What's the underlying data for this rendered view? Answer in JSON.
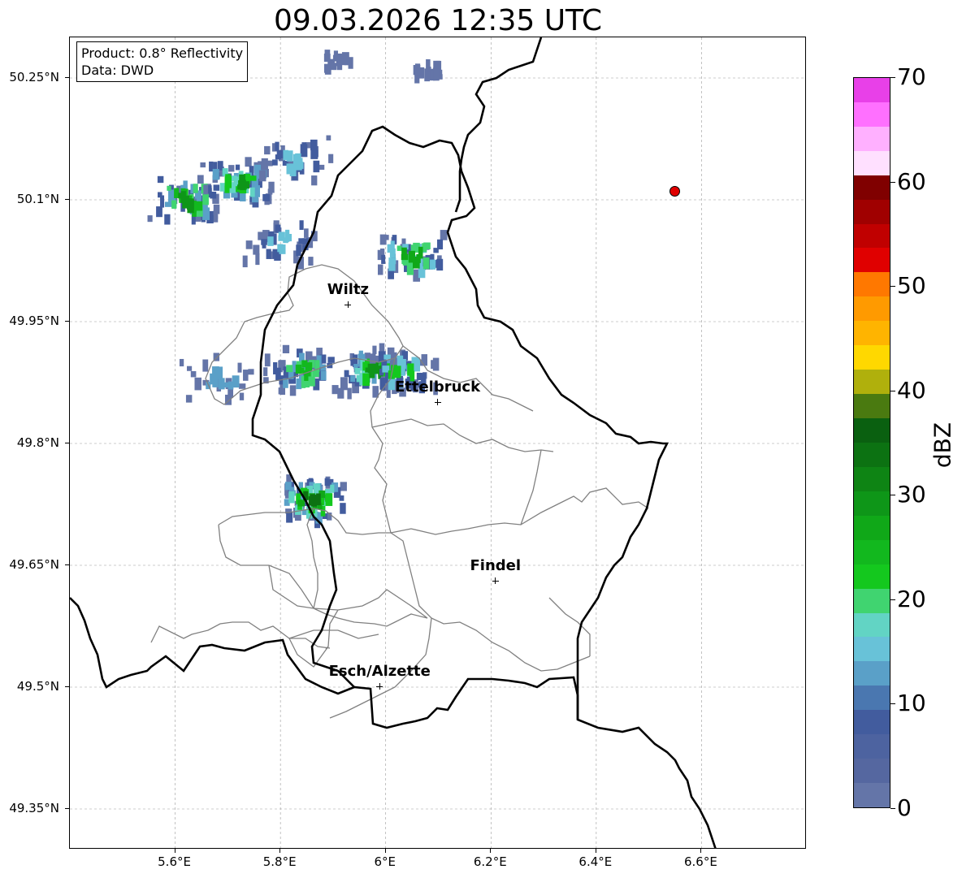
{
  "title": "09.03.2026 12:35 UTC",
  "info_box": {
    "product": "Product: 0.8° Reflectivity",
    "data": "Data: DWD"
  },
  "axes": {
    "lon_ticks": [
      "5.6°E",
      "5.8°E",
      "6°E",
      "6.2°E",
      "6.4°E",
      "6.6°E"
    ],
    "lat_ticks": [
      "50.25°N",
      "50.1°N",
      "49.95°N",
      "49.8°N",
      "49.65°N",
      "49.5°N",
      "49.35°N"
    ],
    "lon_range": [
      5.4,
      6.8
    ],
    "lat_range": [
      49.3,
      50.3
    ],
    "grid": true
  },
  "cities": [
    {
      "name": "Wiltz",
      "lon": 5.93,
      "lat": 49.97
    },
    {
      "name": "Ettelbruck",
      "lon": 6.1,
      "lat": 49.85
    },
    {
      "name": "Findel",
      "lon": 6.21,
      "lat": 49.63
    },
    {
      "name": "Esch/Alzette",
      "lon": 5.99,
      "lat": 49.5
    }
  ],
  "radar_site": {
    "lon": 6.55,
    "lat": 50.11,
    "color": "#e00000"
  },
  "colorbar": {
    "label": "dBZ",
    "ticks": [
      "0",
      "10",
      "20",
      "30",
      "40",
      "50",
      "60",
      "70"
    ],
    "range": [
      0,
      70
    ],
    "colors": [
      "#6475a8",
      "#5567a0",
      "#4d63a0",
      "#425c9e",
      "#4a77b0",
      "#5aa0c8",
      "#68c2d8",
      "#62d4c4",
      "#40d470",
      "#14c81e",
      "#12b81e",
      "#10a818",
      "#0e9618",
      "#0e8414",
      "#0c7212",
      "#0a6010",
      "#4a7a10",
      "#b0b00c",
      "#ffd800",
      "#ffb400",
      "#ff9a00",
      "#ff7800",
      "#e00000",
      "#c00000",
      "#a00000",
      "#800000",
      "#ffe0ff",
      "#ffb0ff",
      "#ff70ff",
      "#e840e8"
    ]
  },
  "echoes": [
    {
      "lon": 5.62,
      "lat": 50.1,
      "dbz": 30
    },
    {
      "lon": 5.72,
      "lat": 50.12,
      "dbz": 28
    },
    {
      "lon": 5.83,
      "lat": 50.15,
      "dbz": 15
    },
    {
      "lon": 6.05,
      "lat": 50.03,
      "dbz": 27
    },
    {
      "lon": 5.84,
      "lat": 49.89,
      "dbz": 25
    },
    {
      "lon": 5.98,
      "lat": 49.89,
      "dbz": 28
    },
    {
      "lon": 6.03,
      "lat": 49.89,
      "dbz": 22
    },
    {
      "lon": 5.68,
      "lat": 49.88,
      "dbz": 12
    },
    {
      "lon": 5.86,
      "lat": 49.73,
      "dbz": 33
    },
    {
      "lon": 5.91,
      "lat": 50.27,
      "dbz": 4
    },
    {
      "lon": 6.08,
      "lat": 50.26,
      "dbz": 4
    },
    {
      "lon": 5.8,
      "lat": 50.05,
      "dbz": 14
    }
  ]
}
